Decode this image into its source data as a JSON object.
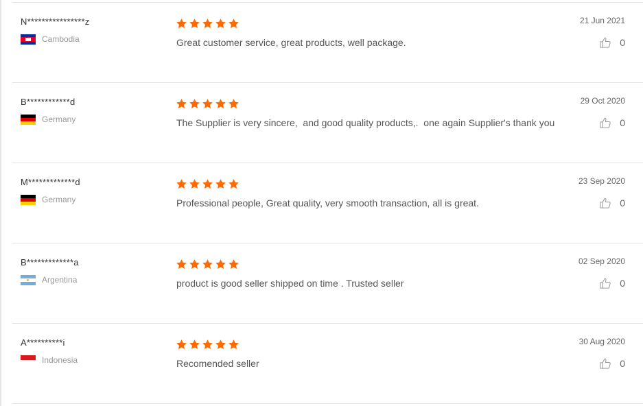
{
  "reviews": [
    {
      "buyer": "N****************z",
      "country": "Cambodia",
      "flag": "cambodia-flag",
      "rating": 5,
      "comment": "Great customer service, great products, well package.",
      "date": "21 Jun 2021",
      "helpful_count": "0"
    },
    {
      "buyer": "B************d",
      "country": "Germany",
      "flag": "germany-flag",
      "rating": 5,
      "comment": "The Supplier is very sincere,  and good quality products,.  one again Supplier's thank you",
      "date": "29 Oct 2020",
      "helpful_count": "0"
    },
    {
      "buyer": "M*************d",
      "country": "Germany",
      "flag": "germany-flag",
      "rating": 5,
      "comment": "Professional people, Great quality, very smooth transaction, all is great.",
      "date": "23 Sep 2020",
      "helpful_count": "0"
    },
    {
      "buyer": "B*************a",
      "country": "Argentina",
      "flag": "argentina-flag",
      "rating": 5,
      "comment": "product is good seller shipped on time . Trusted seller",
      "date": "02 Sep 2020",
      "helpful_count": "0"
    },
    {
      "buyer": "A**********i",
      "country": "Indonesia",
      "flag": "indonesia-flag",
      "rating": 5,
      "comment": "Recomended seller",
      "date": "30 Aug 2020",
      "helpful_count": "0"
    }
  ],
  "colors": {
    "star": "#ff6a00",
    "divider": "#e3e3e3",
    "text": "#555555",
    "muted": "#999999"
  },
  "icons": {
    "star": "star-icon",
    "helpful": "thumbs-up-icon"
  }
}
